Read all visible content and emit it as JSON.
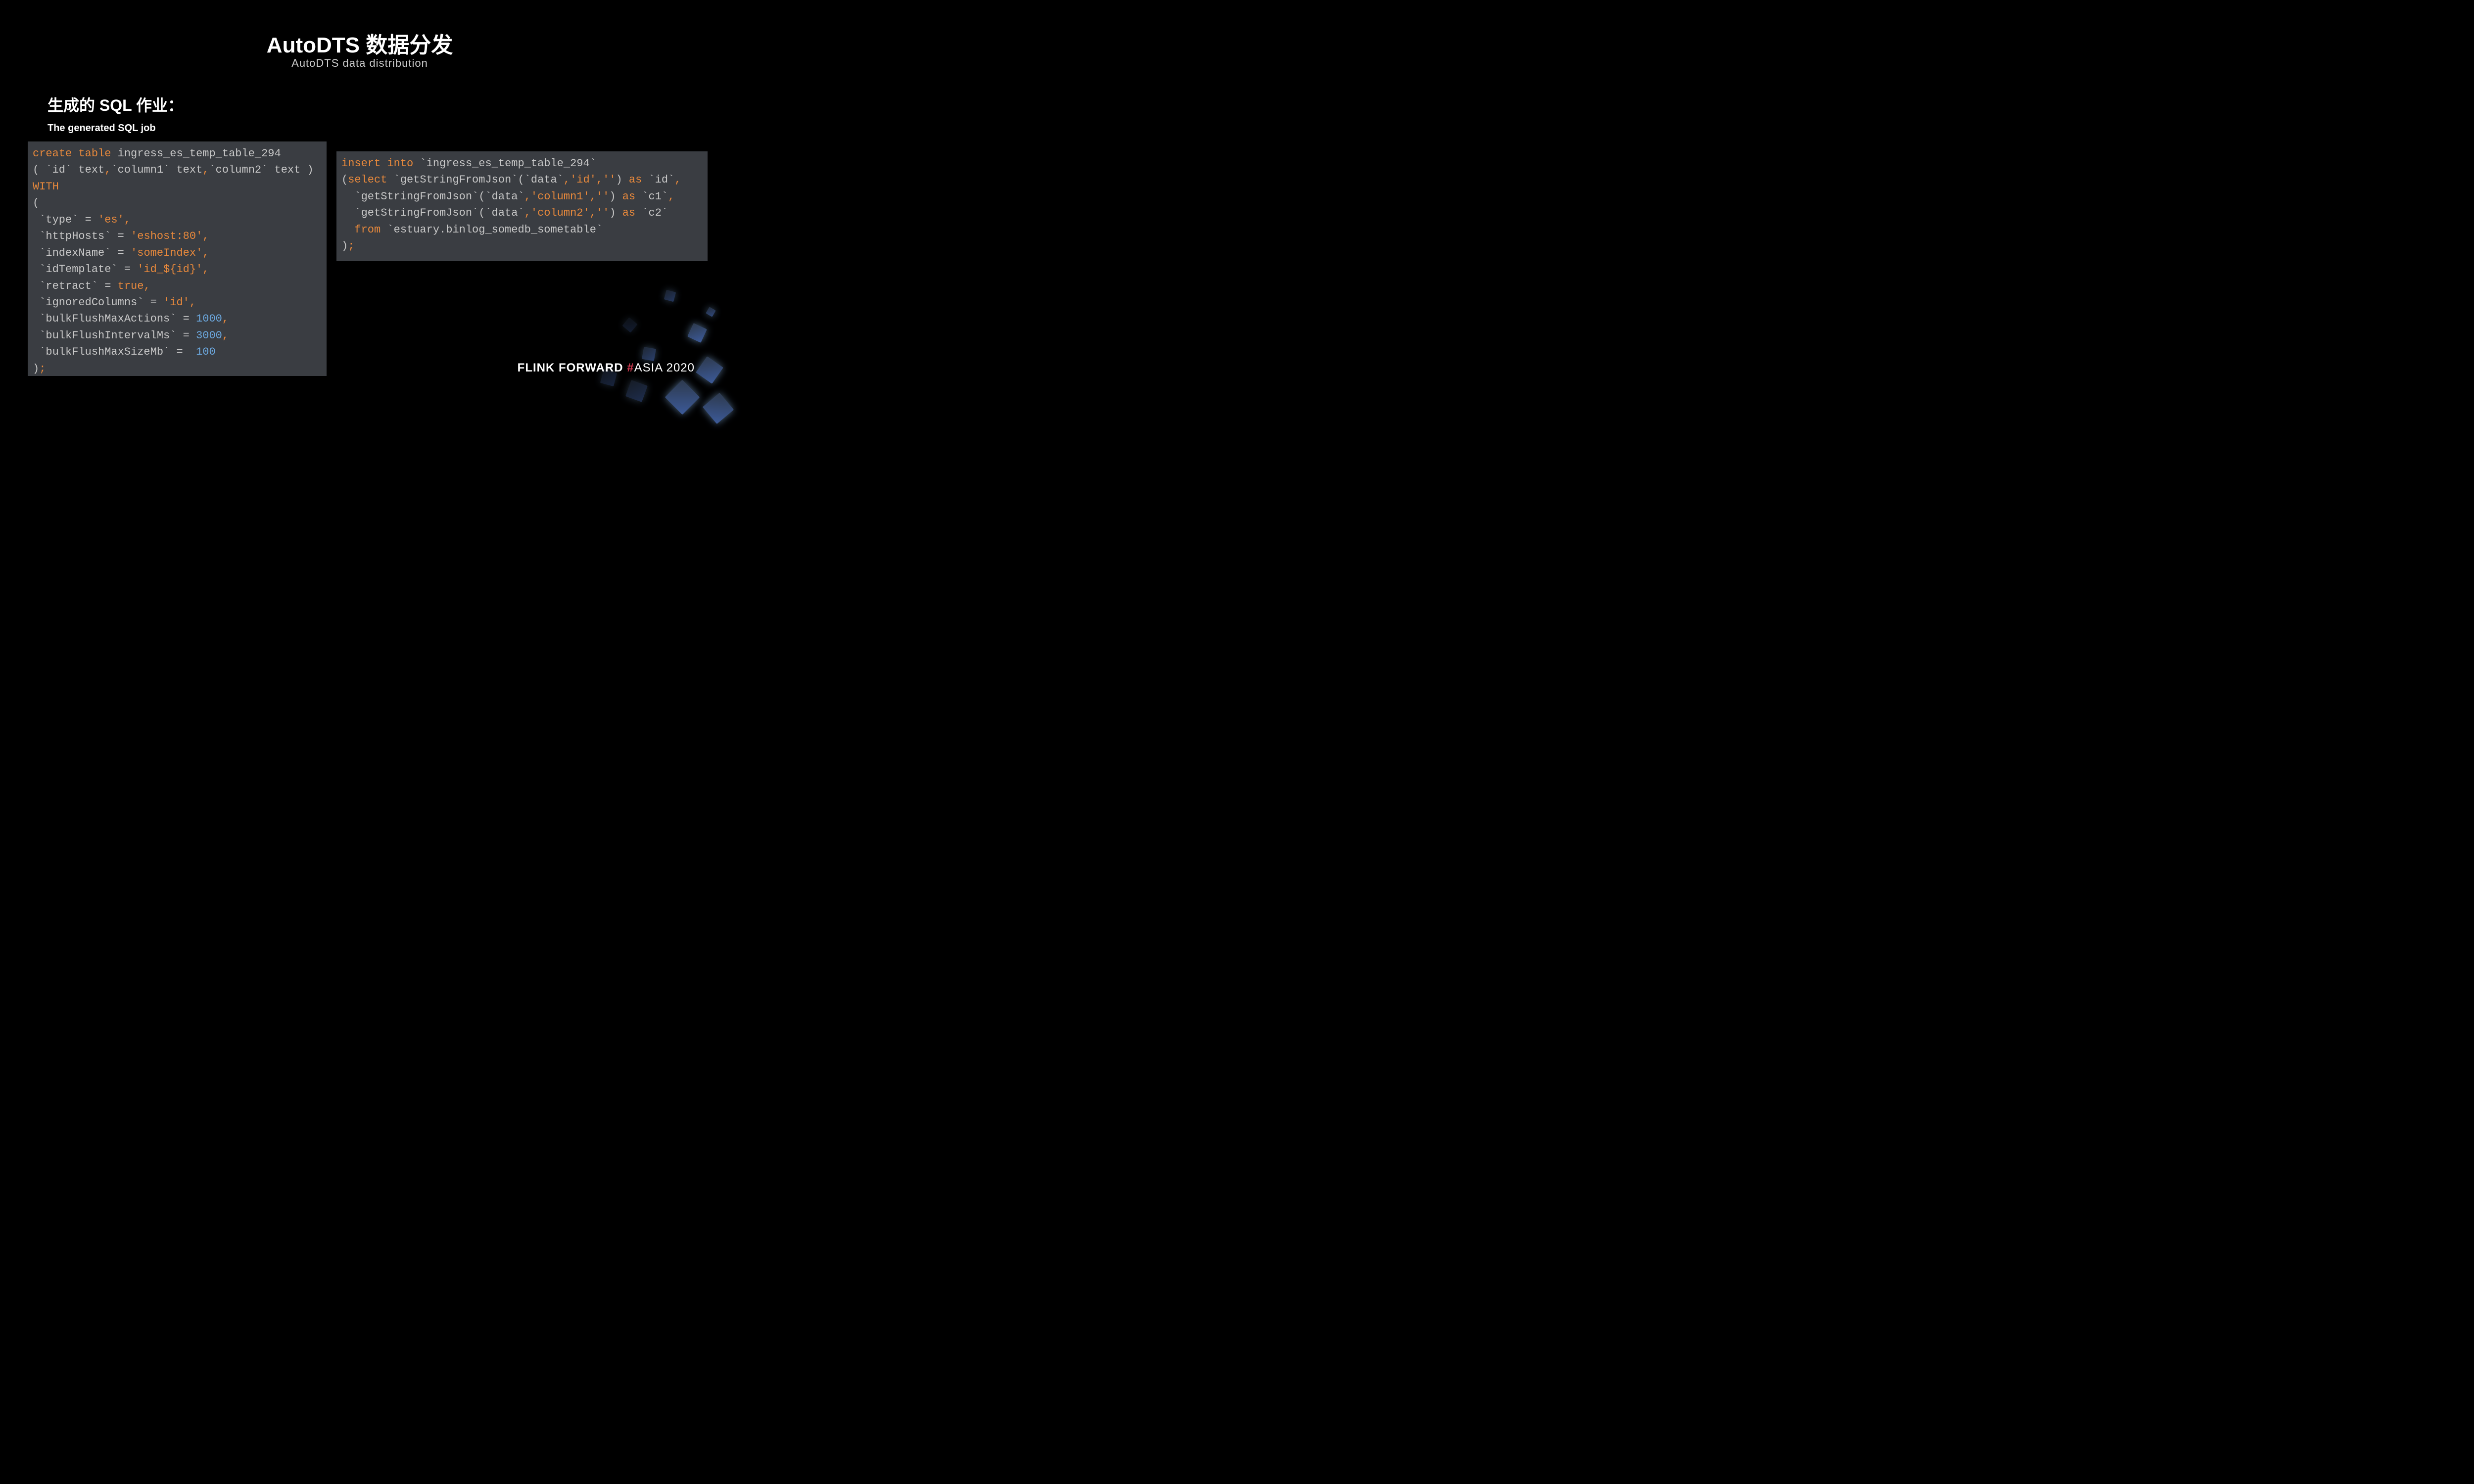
{
  "title": "AutoDTS 数据分发",
  "subtitle": "AutoDTS data distribution",
  "sectionTitle": "生成的 SQL 作业：",
  "sectionSubtitle": "The generated SQL job",
  "codeLeft": {
    "tokens": [
      {
        "t": "create table",
        "c": "kw"
      },
      {
        "t": " ",
        "c": "ident"
      },
      {
        "t": "ingress_es_temp_table_294",
        "c": "ident"
      },
      {
        "t": "\n",
        "c": ""
      },
      {
        "t": "(",
        "c": "punct"
      },
      {
        "t": " `id` text",
        "c": "ident"
      },
      {
        "t": ",",
        "c": "comma-orange"
      },
      {
        "t": "`column1` text",
        "c": "ident"
      },
      {
        "t": ",",
        "c": "comma-orange"
      },
      {
        "t": "`column2` text ",
        "c": "ident"
      },
      {
        "t": ")",
        "c": "punct"
      },
      {
        "t": "\n",
        "c": ""
      },
      {
        "t": "WITH",
        "c": "kw"
      },
      {
        "t": "\n",
        "c": ""
      },
      {
        "t": "(",
        "c": "punct"
      },
      {
        "t": "\n",
        "c": ""
      },
      {
        "t": " `type` = ",
        "c": "ident"
      },
      {
        "t": "'es'",
        "c": "str"
      },
      {
        "t": ",",
        "c": "comma-orange"
      },
      {
        "t": "\n",
        "c": ""
      },
      {
        "t": " `httpHosts` = ",
        "c": "ident"
      },
      {
        "t": "'eshost:80'",
        "c": "str"
      },
      {
        "t": ",",
        "c": "comma-orange"
      },
      {
        "t": "\n",
        "c": ""
      },
      {
        "t": " `indexName` = ",
        "c": "ident"
      },
      {
        "t": "'someIndex'",
        "c": "str"
      },
      {
        "t": ",",
        "c": "comma-orange"
      },
      {
        "t": "\n",
        "c": ""
      },
      {
        "t": " `idTemplate` = ",
        "c": "ident"
      },
      {
        "t": "'id_${id}'",
        "c": "str"
      },
      {
        "t": ",",
        "c": "comma-orange"
      },
      {
        "t": "\n",
        "c": ""
      },
      {
        "t": " `retract` = ",
        "c": "ident"
      },
      {
        "t": "true",
        "c": "bool"
      },
      {
        "t": ",",
        "c": "comma-orange"
      },
      {
        "t": "\n",
        "c": ""
      },
      {
        "t": " `ignoredColumns` = ",
        "c": "ident"
      },
      {
        "t": "'id'",
        "c": "str"
      },
      {
        "t": ",",
        "c": "comma-orange"
      },
      {
        "t": "\n",
        "c": ""
      },
      {
        "t": " `bulkFlushMaxActions` = ",
        "c": "ident"
      },
      {
        "t": "1000",
        "c": "num"
      },
      {
        "t": ",",
        "c": "comma-orange"
      },
      {
        "t": "\n",
        "c": ""
      },
      {
        "t": " `bulkFlushIntervalMs` = ",
        "c": "ident"
      },
      {
        "t": "3000",
        "c": "num"
      },
      {
        "t": ",",
        "c": "comma-orange"
      },
      {
        "t": "\n",
        "c": ""
      },
      {
        "t": " `bulkFlushMaxSizeMb` =  ",
        "c": "ident"
      },
      {
        "t": "100",
        "c": "num"
      },
      {
        "t": "\n",
        "c": ""
      },
      {
        "t": ")",
        "c": "punct"
      },
      {
        "t": ";",
        "c": "comma-orange"
      }
    ]
  },
  "codeRight": {
    "tokens": [
      {
        "t": "insert into",
        "c": "kw"
      },
      {
        "t": " `ingress_es_temp_table_294`",
        "c": "ident"
      },
      {
        "t": "\n",
        "c": ""
      },
      {
        "t": "(",
        "c": "punct"
      },
      {
        "t": "select",
        "c": "kw"
      },
      {
        "t": " `getStringFromJson`(`data`",
        "c": "ident"
      },
      {
        "t": ",",
        "c": "comma-orange"
      },
      {
        "t": "'id'",
        "c": "str"
      },
      {
        "t": ",",
        "c": "comma-orange"
      },
      {
        "t": "''",
        "c": "str"
      },
      {
        "t": ")",
        "c": "punct"
      },
      {
        "t": " as",
        "c": "kw"
      },
      {
        "t": " `id`",
        "c": "ident"
      },
      {
        "t": ",",
        "c": "comma-orange"
      },
      {
        "t": "\n",
        "c": ""
      },
      {
        "t": "  `getStringFromJson`(`data`",
        "c": "ident"
      },
      {
        "t": ",",
        "c": "comma-orange"
      },
      {
        "t": "'column1'",
        "c": "str"
      },
      {
        "t": ",",
        "c": "comma-orange"
      },
      {
        "t": "''",
        "c": "str"
      },
      {
        "t": ")",
        "c": "punct"
      },
      {
        "t": " as",
        "c": "kw"
      },
      {
        "t": " `c1`",
        "c": "ident"
      },
      {
        "t": ",",
        "c": "comma-orange"
      },
      {
        "t": "\n",
        "c": ""
      },
      {
        "t": "  `getStringFromJson`(`data`",
        "c": "ident"
      },
      {
        "t": ",",
        "c": "comma-orange"
      },
      {
        "t": "'column2'",
        "c": "str"
      },
      {
        "t": ",",
        "c": "comma-orange"
      },
      {
        "t": "''",
        "c": "str"
      },
      {
        "t": ")",
        "c": "punct"
      },
      {
        "t": " as",
        "c": "kw"
      },
      {
        "t": " `c2`",
        "c": "ident"
      },
      {
        "t": "\n",
        "c": ""
      },
      {
        "t": "  from",
        "c": "kw"
      },
      {
        "t": " `estuary.binlog_somedb_sometable`",
        "c": "ident"
      },
      {
        "t": "\n",
        "c": ""
      },
      {
        "t": ")",
        "c": "punct"
      },
      {
        "t": ";",
        "c": "comma-orange"
      }
    ]
  },
  "logo": {
    "part1": "FLINK FORWARD ",
    "hash": "#",
    "part2": "ASIA 2020"
  }
}
